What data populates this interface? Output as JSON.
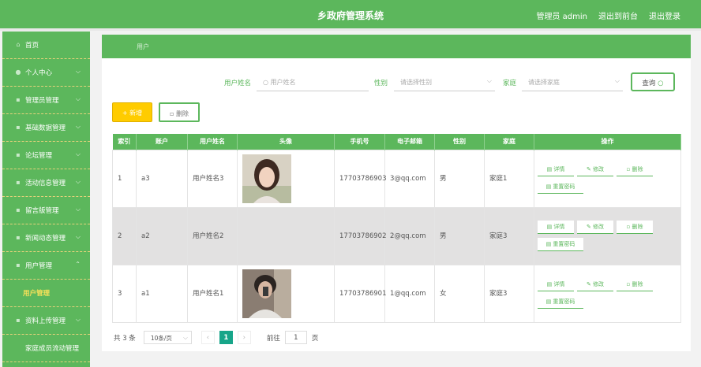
{
  "header": {
    "title": "乡政府管理系统",
    "admin_label": "管理员 admin",
    "front_link": "退出到前台",
    "logout_link": "退出登录"
  },
  "sidebar": {
    "items": [
      {
        "label": "首页",
        "icon": "home-icon",
        "has_chevron": false
      },
      {
        "label": "个人中心",
        "icon": "user-icon",
        "has_chevron": true
      },
      {
        "label": "管理员管理",
        "icon": "menu-icon",
        "has_chevron": true
      },
      {
        "label": "基础数据管理",
        "icon": "menu-icon",
        "has_chevron": true
      },
      {
        "label": "论坛管理",
        "icon": "menu-icon",
        "has_chevron": true
      },
      {
        "label": "活动信息管理",
        "icon": "menu-icon",
        "has_chevron": true
      },
      {
        "label": "留言版管理",
        "icon": "menu-icon",
        "has_chevron": true
      },
      {
        "label": "新闻动态管理",
        "icon": "menu-icon",
        "has_chevron": true
      },
      {
        "label": "用户管理",
        "icon": "menu-icon",
        "has_chevron": true,
        "expanded": true
      },
      {
        "label": "用户管理",
        "sub": true
      },
      {
        "label": "资料上传管理",
        "icon": "menu-icon",
        "has_chevron": true
      },
      {
        "label": "家庭成员流动管理",
        "icon": "menu-icon",
        "has_chevron": false
      }
    ]
  },
  "breadcrumb": "用户",
  "search": {
    "name_label": "用户姓名",
    "name_placeholder": "用户姓名",
    "gender_label": "性别",
    "gender_placeholder": "请选择性别",
    "family_label": "家庭",
    "family_placeholder": "请选择家庭",
    "query_button": "查询"
  },
  "actions": {
    "add": "新增",
    "delete": "删除"
  },
  "table": {
    "headers": [
      "索引",
      "账户",
      "用户姓名",
      "头像",
      "手机号",
      "电子邮箱",
      "性别",
      "家庭",
      "操作"
    ],
    "rows": [
      {
        "index": "1",
        "account": "a3",
        "name": "用户姓名3",
        "avatar": "photo",
        "phone": "17703786903",
        "email": "3@qq.com",
        "gender": "男",
        "family": "家庭1"
      },
      {
        "index": "2",
        "account": "a2",
        "name": "用户姓名2",
        "avatar": "",
        "phone": "17703786902",
        "email": "2@qq.com",
        "gender": "男",
        "family": "家庭3"
      },
      {
        "index": "3",
        "account": "a1",
        "name": "用户姓名1",
        "avatar": "photo",
        "phone": "17703786901",
        "email": "1@qq.com",
        "gender": "女",
        "family": "家庭3"
      }
    ],
    "ops": {
      "detail": "详情",
      "edit": "修改",
      "delete": "删除",
      "reset": "重置密码"
    }
  },
  "pager": {
    "total": "共 3 条",
    "size": "10条/页",
    "prev": "‹",
    "current": "1",
    "next": "›",
    "goto": "前往",
    "goto_value": "1",
    "page_unit": "页"
  },
  "colors": {
    "primary": "#5cb75c",
    "accent": "#17a589",
    "add_button": "#ffcc00",
    "sub_active": "#f7e15a"
  }
}
